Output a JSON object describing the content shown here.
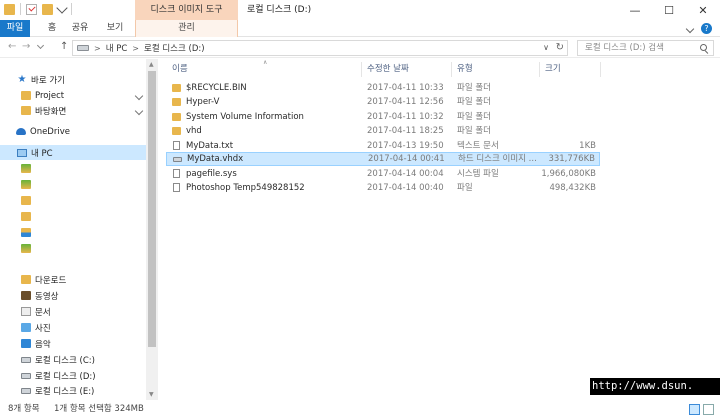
{
  "window": {
    "title": "로컬 디스크 (D:)",
    "context_tab_group": "디스크 이미지 도구",
    "controls": {
      "minimize": "—",
      "maximize": "☐",
      "close": "✕"
    }
  },
  "ribbon": {
    "tabs": [
      {
        "label": "파일"
      },
      {
        "label": "홈"
      },
      {
        "label": "공유"
      },
      {
        "label": "보기"
      },
      {
        "label": "관리"
      }
    ],
    "help": "?"
  },
  "nav": {
    "back": "←",
    "forward": "→",
    "up": "↑",
    "breadcrumb": [
      "내 PC",
      "로컬 디스크 (D:)"
    ],
    "refresh": "↻",
    "search_placeholder": "로컬 디스크 (D:) 검색"
  },
  "sidebar": {
    "items": [
      {
        "label": "바로 가기",
        "icon": "star-icon"
      },
      {
        "label": "Project",
        "icon": "folder-icon"
      },
      {
        "label": "바탕화면",
        "icon": "folder-icon"
      },
      {
        "label": "OneDrive",
        "icon": "cloud-icon"
      },
      {
        "label": "내 PC",
        "icon": "pc-icon"
      },
      {
        "label": "",
        "icon": "folder-icon"
      },
      {
        "label": "",
        "icon": "folder-icon"
      },
      {
        "label": "",
        "icon": "folder-icon"
      },
      {
        "label": "",
        "icon": "folder-icon"
      },
      {
        "label": "",
        "icon": "folder-icon"
      },
      {
        "label": "",
        "icon": "folder-icon"
      },
      {
        "label": "다운로드",
        "icon": "downloads-folder-icon"
      },
      {
        "label": "동영상",
        "icon": "videos-folder-icon"
      },
      {
        "label": "문서",
        "icon": "documents-folder-icon"
      },
      {
        "label": "사진",
        "icon": "pictures-folder-icon"
      },
      {
        "label": "음악",
        "icon": "music-folder-icon"
      },
      {
        "label": "로컬 디스크 (C:)",
        "icon": "drive-icon"
      },
      {
        "label": "로컬 디스크 (D:)",
        "icon": "drive-icon"
      },
      {
        "label": "로컬 디스크 (E:)",
        "icon": "drive-icon"
      }
    ]
  },
  "file_list": {
    "columns": {
      "name": "이름",
      "date": "수정한 날짜",
      "type": "유형",
      "size": "크기"
    },
    "rows": [
      {
        "name": "$RECYCLE.BIN",
        "date": "2017-04-11 10:33",
        "type": "파일 폴더",
        "size": "",
        "icon": "folder-icon"
      },
      {
        "name": "Hyper-V",
        "date": "2017-04-11 12:56",
        "type": "파일 폴더",
        "size": "",
        "icon": "folder-icon"
      },
      {
        "name": "System Volume Information",
        "date": "2017-04-11 10:32",
        "type": "파일 폴더",
        "size": "",
        "icon": "folder-icon"
      },
      {
        "name": "vhd",
        "date": "2017-04-11 18:25",
        "type": "파일 폴더",
        "size": "",
        "icon": "folder-icon"
      },
      {
        "name": "MyData.txt",
        "date": "2017-04-13 19:50",
        "type": "텍스트 문서",
        "size": "1KB",
        "icon": "text-file-icon"
      },
      {
        "name": "MyData.vhdx",
        "date": "2017-04-14 00:41",
        "type": "하드 디스크 이미지 ...",
        "size": "331,776KB",
        "icon": "disk-image-icon"
      },
      {
        "name": "pagefile.sys",
        "date": "2017-04-14 00:04",
        "type": "시스템 파일",
        "size": "1,966,080KB",
        "icon": "system-file-icon"
      },
      {
        "name": "Photoshop Temp549828152",
        "date": "2017-04-14 00:40",
        "type": "파일",
        "size": "498,432KB",
        "icon": "file-icon"
      }
    ]
  },
  "status": {
    "item_count": "8개 항목",
    "selection": "1개 항목 선택함 324MB"
  },
  "watermark": "http://www.dsun."
}
